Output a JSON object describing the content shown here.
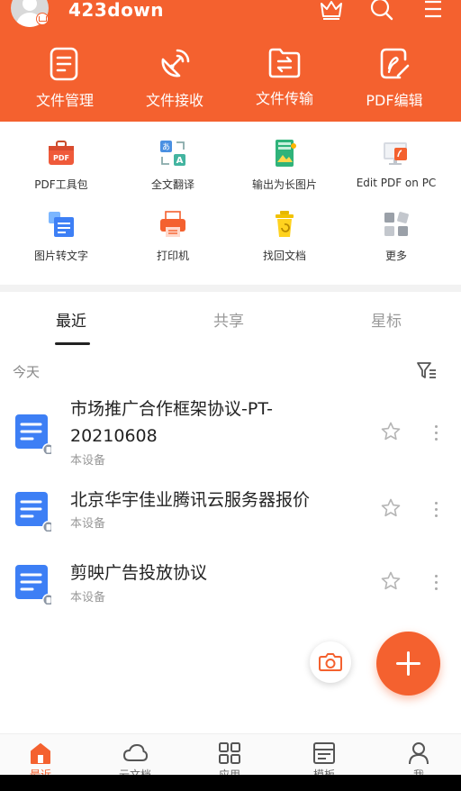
{
  "header": {
    "username": "423down",
    "actions": [
      {
        "label": "文件管理",
        "icon": "file-manage-icon"
      },
      {
        "label": "文件接收",
        "icon": "satellite-receive-icon"
      },
      {
        "label": "文件传输",
        "icon": "folder-transfer-icon"
      },
      {
        "label": "PDF编辑",
        "icon": "pdf-edit-icon"
      }
    ]
  },
  "tools": [
    {
      "label": "PDF工具包",
      "icon": "pdf-toolbox-icon"
    },
    {
      "label": "全文翻译",
      "icon": "translate-icon"
    },
    {
      "label": "输出为长图片",
      "icon": "long-image-icon"
    },
    {
      "label": "Edit PDF on PC",
      "icon": "pc-edit-icon"
    },
    {
      "label": "图片转文字",
      "icon": "image-to-text-icon"
    },
    {
      "label": "打印机",
      "icon": "printer-icon"
    },
    {
      "label": "找回文档",
      "icon": "recover-doc-icon"
    },
    {
      "label": "更多",
      "icon": "more-grid-icon"
    }
  ],
  "tabs": [
    {
      "label": "最近",
      "active": true
    },
    {
      "label": "共享",
      "active": false
    },
    {
      "label": "星标",
      "active": false
    }
  ],
  "section_label": "今天",
  "files": [
    {
      "title": "市场推广合作框架协议-PT-20210608",
      "location": "本设备"
    },
    {
      "title": "北京华宇佳业腾讯云服务器报价",
      "location": "本设备"
    },
    {
      "title": "剪映广告投放协议",
      "location": "本设备"
    }
  ],
  "bottom_nav": [
    {
      "label": "最近",
      "icon": "home-icon",
      "active": true
    },
    {
      "label": "云文档",
      "icon": "cloud-icon",
      "active": false
    },
    {
      "label": "应用",
      "icon": "apps-grid-icon",
      "active": false
    },
    {
      "label": "模板",
      "icon": "template-icon",
      "active": false
    },
    {
      "label": "我",
      "icon": "profile-icon",
      "active": false
    }
  ],
  "colors": {
    "accent": "#f4612f",
    "doc_blue": "#3d7ff5"
  }
}
